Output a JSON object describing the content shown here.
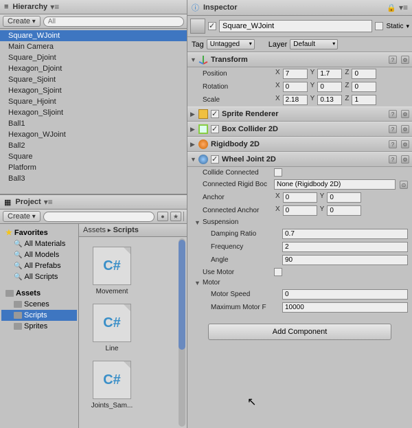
{
  "hierarchy": {
    "tab": "Hierarchy",
    "create": "Create",
    "search_placeholder": "All",
    "items": [
      "Square_WJoint",
      "Main Camera",
      "Square_Djoint",
      "Hexagon_Djoint",
      "Square_Sjoint",
      "Hexagon_Sjoint",
      "Square_Hjoint",
      "Hexagon_Sljoint",
      "Ball1",
      "Hexagon_WJoint",
      "Ball2",
      "Square",
      "Platform",
      "Ball3"
    ],
    "selected": 0
  },
  "project": {
    "tab": "Project",
    "create": "Create",
    "favorites_label": "Favorites",
    "favorites": [
      "All Materials",
      "All Models",
      "All Prefabs",
      "All Scripts"
    ],
    "assets_label": "Assets",
    "folders": [
      "Scenes",
      "Scripts",
      "Sprites"
    ],
    "selected_folder": 1,
    "breadcrumb": [
      "Assets",
      "Scripts"
    ],
    "assets": [
      "Joints_Sam...",
      "Line",
      "Movement"
    ]
  },
  "inspector": {
    "tab": "Inspector",
    "obj_enabled": true,
    "obj_name": "Square_WJoint",
    "static_label": "Static",
    "static": false,
    "tag_label": "Tag",
    "tag_value": "Untagged",
    "layer_label": "Layer",
    "layer_value": "Default",
    "transform": {
      "title": "Transform",
      "position_label": "Position",
      "rotation_label": "Rotation",
      "scale_label": "Scale",
      "position": {
        "x": "7",
        "y": "1.7",
        "z": "0"
      },
      "rotation": {
        "x": "0",
        "y": "0",
        "z": "0"
      },
      "scale": {
        "x": "2.18",
        "y": "0.13",
        "z": "1"
      }
    },
    "components": {
      "sprite_renderer": "Sprite Renderer",
      "box_collider": "Box Collider 2D",
      "rigidbody": "Rigidbody 2D",
      "wheel_joint": "Wheel Joint 2D"
    },
    "wheel_joint": {
      "enabled": true,
      "collide_connected_label": "Collide Connected",
      "collide_connected": false,
      "connected_rb_label": "Connected Rigid Boc",
      "connected_rb_value": "None (Rigidbody 2D)",
      "anchor_label": "Anchor",
      "anchor": {
        "x": "0",
        "y": "0"
      },
      "connected_anchor_label": "Connected Anchor",
      "connected_anchor": {
        "x": "0",
        "y": "0"
      },
      "suspension_label": "Suspension",
      "damping_label": "Damping Ratio",
      "damping": "0.7",
      "frequency_label": "Frequency",
      "frequency": "2",
      "angle_label": "Angle",
      "angle": "90",
      "use_motor_label": "Use Motor",
      "use_motor": false,
      "motor_label": "Motor",
      "motor_speed_label": "Motor Speed",
      "motor_speed": "0",
      "max_force_label": "Maximum Motor F",
      "max_force": "10000"
    },
    "add_component": "Add Component"
  }
}
